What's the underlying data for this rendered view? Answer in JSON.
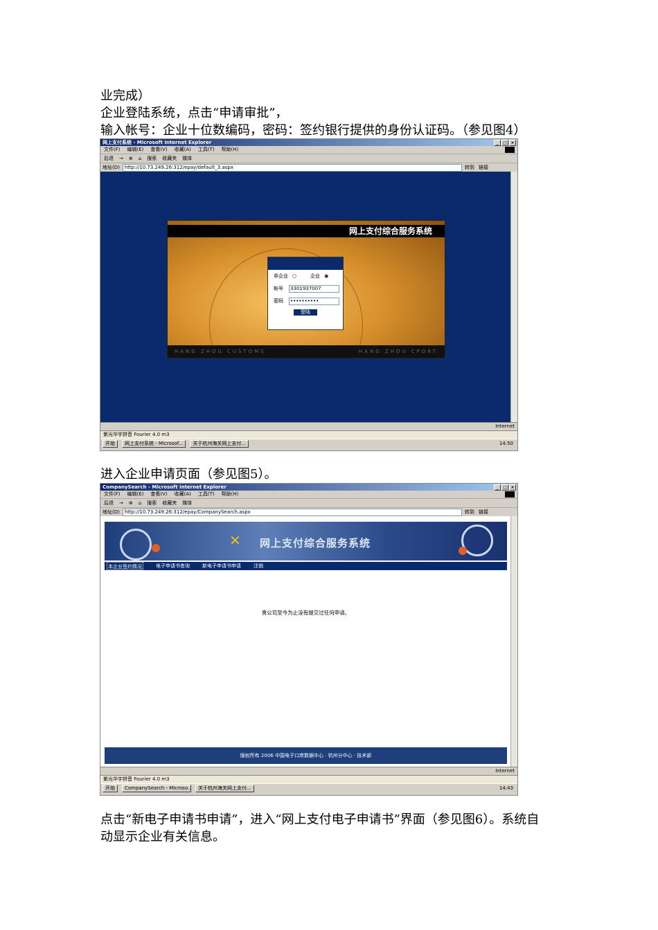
{
  "doc": {
    "line1": "业完成）",
    "line2": "企业登陆系统，点击“申请审批”，",
    "line3": "输入帐号：企业十位数编码，密码：签约银行提供的身份认证码。（参见图4）",
    "line4": "进入企业申请页面（参见图5）。",
    "line5": "点击“新电子申请书申请”，进入“网上支付电子申请书”界面（参见图6）。系统自",
    "line6": "动显示企业有关信息。"
  },
  "ie_menu": [
    "文件(F)",
    "编辑(E)",
    "查看(V)",
    "收藏(A)",
    "工具(T)",
    "帮助(H)"
  ],
  "ie_toolbar": [
    "后退",
    "→",
    "⊗",
    "⌂",
    "搜索",
    "收藏夹",
    "媒体"
  ],
  "ie_address_label": "地址(D)",
  "ie_go": "转到",
  "ie_links": "链接",
  "window1": {
    "title": "网上支付系统 - Microsoft Internet Explorer",
    "url": "http://10.73.249.26:312/epay/default_3.aspx",
    "banner_title": "网上支付综合服务系统",
    "radio_non_enterprise": "非企业",
    "radio_enterprise": "企业",
    "account_label": "帐号",
    "account_value": "3301937007",
    "password_label": "密码",
    "password_value": "••••••••••",
    "login_button": "登陆",
    "footer_left": "HANG   ZHOU   CUSTOMS",
    "footer_right": "HANG   ZHOU   CPORT",
    "status_zone": "Internet",
    "ime": "紫光华宇拼音 Fourier 4.0 m3",
    "start": "开始",
    "task1": "网上支付系统 - Microsof...",
    "task2": "关于杭州海关网上支付...",
    "clock": "14:50"
  },
  "window2": {
    "title": "CompanySearch - Microsoft Internet Explorer",
    "url": "http://10.73.249.26:312/epay/CompanySearch.aspx",
    "banner_title": "网上支付综合服务系统",
    "nav": [
      "本企业签约情况",
      "电子申请书查询",
      "新电子申请书申请",
      "注销"
    ],
    "message": "贵公司至今为止没有提交过任何申请。",
    "footer": "版权所有  2006 中国电子口岸数据中心 · 杭州分中心 · 技术部",
    "status_zone": "Internet",
    "ime": "紫光华宇拼音 Fourier 4.0 m3",
    "start": "开始",
    "task1": "CompanySearch - Microso...",
    "task2": "关于杭州海关网上支付...",
    "clock": "14:43"
  }
}
